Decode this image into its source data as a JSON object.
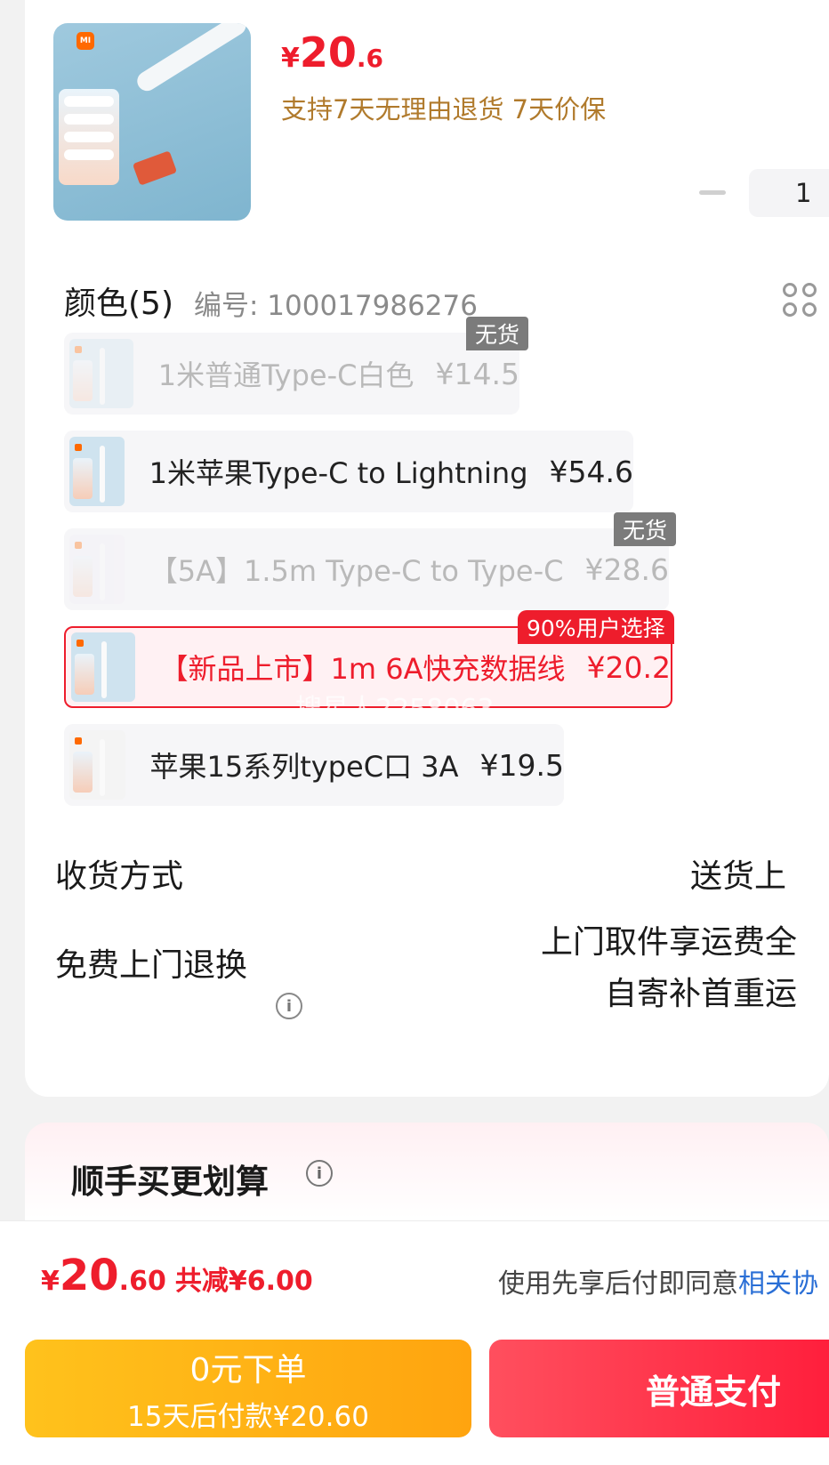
{
  "product": {
    "brand_logo": "MI",
    "price_symbol": "¥",
    "price_int": "20",
    "price_dec": ".6",
    "service": "支持7天无理由退货 7天价保",
    "quantity": "1"
  },
  "spec": {
    "color_title": "颜色(5)",
    "sku_code": "编号: 100017986276",
    "variants": [
      {
        "label": "1米普通Type-C白色",
        "price": "¥14.5",
        "tag": "无货",
        "state": "out-of-stock"
      },
      {
        "label": "1米苹果Type-C to Lightning",
        "price": "¥54.6",
        "tag": "",
        "state": "available"
      },
      {
        "label": "【5A】1.5m Type-C to Type-C",
        "price": "¥28.6",
        "tag": "无货",
        "state": "out-of-stock"
      },
      {
        "label": "【新品上市】1m 6A快充数据线",
        "price": "¥20.2",
        "tag": "90%用户选择",
        "state": "selected"
      },
      {
        "label": "苹果15系列typeC口 3A",
        "price": "¥19.5",
        "tag": "",
        "state": "available"
      }
    ],
    "watermark": "搜星人2258063"
  },
  "delivery": {
    "label": "收货方式",
    "value": "送货上"
  },
  "returns": {
    "label": "免费上门退换",
    "line1": "上门取件享运费全",
    "line2": "自寄补首重运"
  },
  "bundle": {
    "title": "顺手买更划算"
  },
  "footer": {
    "total_symbol": "¥",
    "total_int": "20",
    "total_dec": ".60",
    "discount": "共减¥6.00",
    "agree_text": "使用先享后付即同意",
    "agree_link": "相关协",
    "paylater_line1": "0元下单",
    "paylater_line2": "15天后付款¥20.60",
    "pay_label": "普通支付"
  },
  "colors": {
    "accent_red": "#ee1d2c",
    "service_gold": "#b07a2c",
    "paylater_yellow": "#ffb317",
    "link_blue": "#2a6fd6"
  }
}
